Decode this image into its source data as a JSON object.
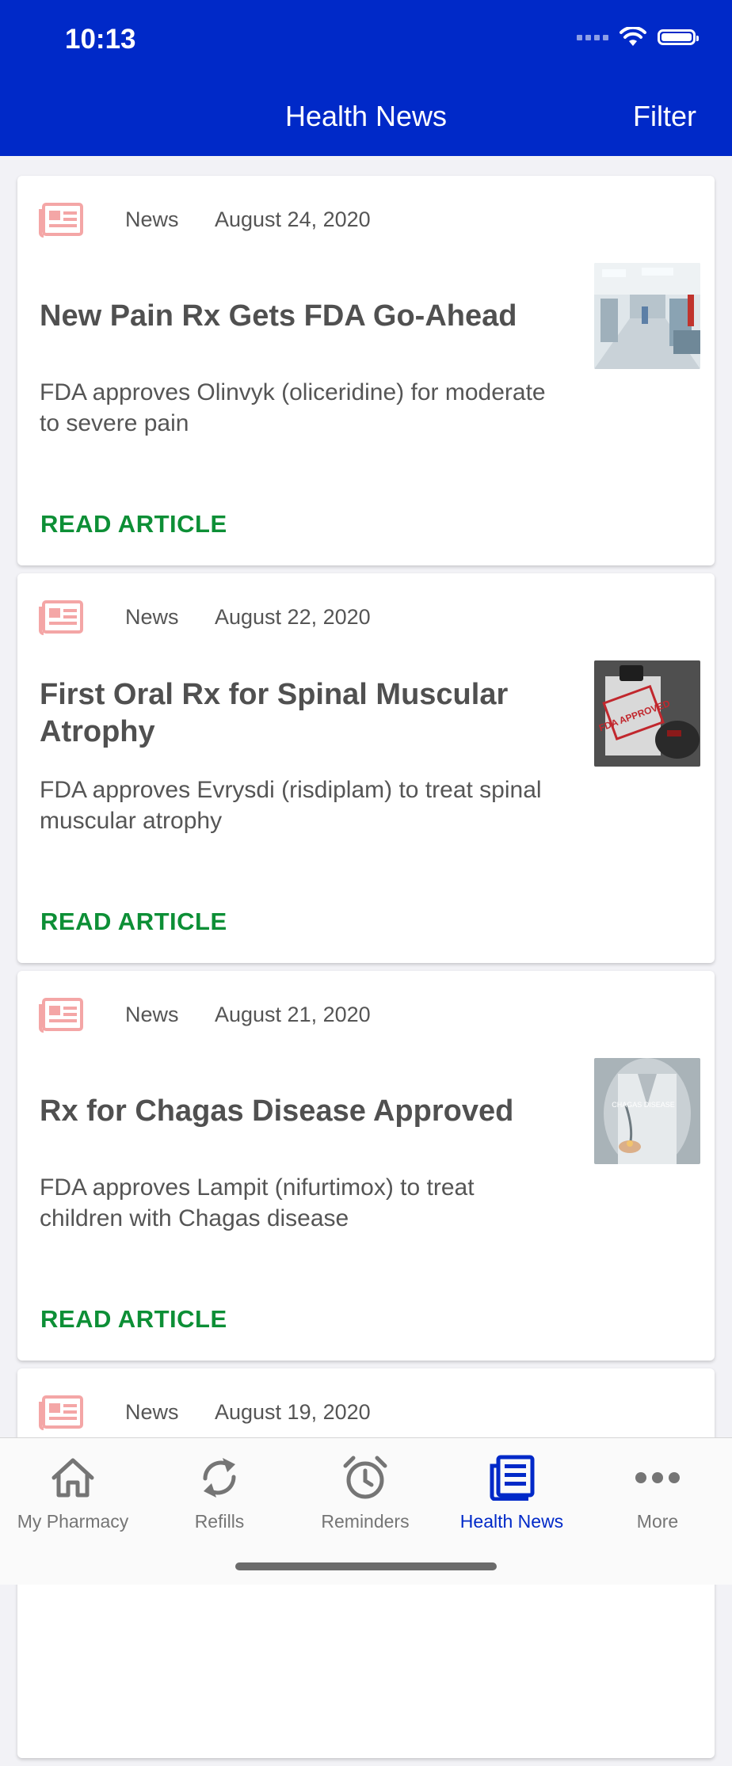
{
  "status": {
    "time": "10:13"
  },
  "nav": {
    "title": "Health News",
    "filter_label": "Filter"
  },
  "articles": [
    {
      "type": "News",
      "date": "August 24, 2020",
      "title": "New Pain Rx Gets FDA Go-Ahead",
      "description": "FDA approves Olinvyk (oliceridine) for moderate to severe pain",
      "link_label": "READ ARTICLE",
      "thumbnail": "hospital-corridor-image"
    },
    {
      "type": "News",
      "date": "August 22, 2020",
      "title": "First Oral Rx for Spinal Muscular Atrophy",
      "description": "FDA approves Evrysdi (risdiplam) to treat spinal muscular atrophy",
      "link_label": "READ ARTICLE",
      "thumbnail": "fda-approved-stamp-image",
      "thumbnail_text": "FDA APPROVED"
    },
    {
      "type": "News",
      "date": "August 21, 2020",
      "title": "Rx for Chagas Disease Approved",
      "description": "FDA approves Lampit (nifurtimox) to treat children with Chagas disease",
      "link_label": "READ ARTICLE",
      "thumbnail": "doctor-chagas-disease-image",
      "thumbnail_text": "CHAGAS DISEASE"
    },
    {
      "type": "News",
      "date": "August 19, 2020"
    }
  ],
  "tabs": [
    {
      "label": "My Pharmacy",
      "icon": "home-icon"
    },
    {
      "label": "Refills",
      "icon": "refresh-icon"
    },
    {
      "label": "Reminders",
      "icon": "alarm-clock-icon"
    },
    {
      "label": "Health News",
      "icon": "newspaper-icon",
      "active": true
    },
    {
      "label": "More",
      "icon": "more-dots-icon"
    }
  ],
  "colors": {
    "header": "#0029c8",
    "link_green": "#0d8f36",
    "news_icon": "#f4a6a6",
    "active_tab": "#0029c8",
    "inactive_tab": "#757575"
  }
}
